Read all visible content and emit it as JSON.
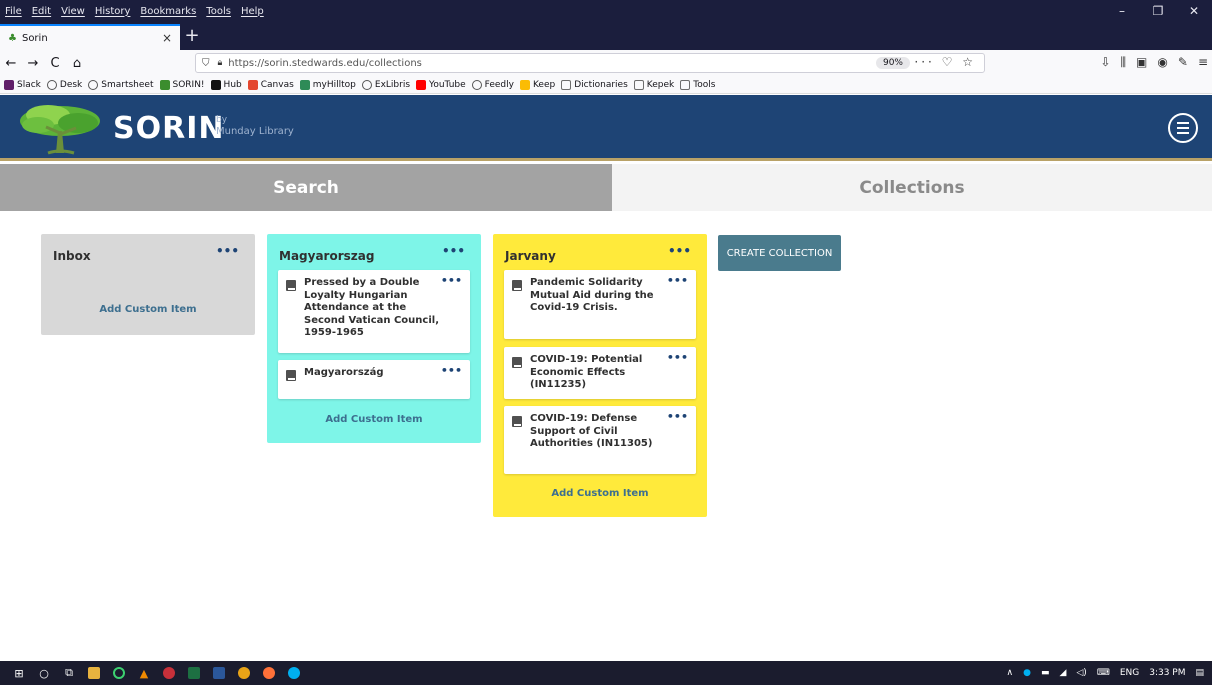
{
  "browser": {
    "menu": [
      "File",
      "Edit",
      "View",
      "History",
      "Bookmarks",
      "Tools",
      "Help"
    ],
    "window_controls": [
      "–",
      "❐",
      "✕"
    ],
    "tab": {
      "title": "Sorin",
      "close": "×"
    },
    "new_tab": "+",
    "nav": {
      "back": "←",
      "forward": "→",
      "reload": "C",
      "home": "⌂"
    },
    "url": "https://sorin.stedwards.edu/collections",
    "zoom": "90%",
    "url_actions": "··· ♡ ☆",
    "bookmarks": [
      {
        "label": "Slack",
        "icon": "slack-icon",
        "color": "#611f69"
      },
      {
        "label": "Desk",
        "icon": "globe-icon",
        "color": "#555555"
      },
      {
        "label": "Smartsheet",
        "icon": "globe-icon",
        "color": "#555555"
      },
      {
        "label": "SORIN!",
        "icon": "tree-icon",
        "color": "#3b8d2e"
      },
      {
        "label": "Hub",
        "icon": "notion-icon",
        "color": "#111111"
      },
      {
        "label": "Canvas",
        "icon": "canvas-icon",
        "color": "#e4472f"
      },
      {
        "label": "myHilltop",
        "icon": "hilltop-icon",
        "color": "#2e8b57"
      },
      {
        "label": "ExLibris",
        "icon": "globe-icon",
        "color": "#555555"
      },
      {
        "label": "YouTube",
        "icon": "youtube-icon",
        "color": "#ff0000"
      },
      {
        "label": "Feedly",
        "icon": "globe-icon",
        "color": "#555555"
      },
      {
        "label": "Keep",
        "icon": "keep-icon",
        "color": "#fbbc04"
      },
      {
        "label": "Dictionaries",
        "icon": "folder-icon",
        "color": "#6d6d6d"
      },
      {
        "label": "Kepek",
        "icon": "folder-icon",
        "color": "#6d6d6d"
      },
      {
        "label": "Tools",
        "icon": "folder-icon",
        "color": "#6d6d6d"
      }
    ]
  },
  "header": {
    "brand": "SORIN",
    "by": "by",
    "subtitle": "Munday Library",
    "colors": {
      "bar": "#1e4475",
      "accent": "#b9a267"
    }
  },
  "tabs": {
    "search": "Search",
    "collections": "Collections"
  },
  "columns": {
    "inbox": {
      "title": "Inbox",
      "dots": "•••",
      "add": "Add Custom Item",
      "color": "#d8d8d8"
    },
    "magyarorszag": {
      "title": "Magyarorszag",
      "dots": "•••",
      "add": "Add Custom Item",
      "color": "#7ef5e8",
      "items": [
        {
          "title": "Pressed by a Double Loyalty Hungarian Attendance at the Second Vatican Council, 1959-1965",
          "dots": "•••"
        },
        {
          "title": "Magyarország",
          "dots": "•••"
        }
      ]
    },
    "jarvany": {
      "title": "Jarvany",
      "dots": "•••",
      "add": "Add Custom Item",
      "color": "#ffea3b",
      "items": [
        {
          "title": "Pandemic Solidarity Mutual Aid during the Covid-19 Crisis.",
          "dots": "•••"
        },
        {
          "title": "COVID-19: Potential Economic Effects (IN11235)",
          "dots": "•••"
        },
        {
          "title": "COVID-19: Defense Support of Civil Authorities (IN11305)",
          "dots": "•••"
        }
      ]
    }
  },
  "create_button": "CREATE COLLECTION",
  "taskbar": {
    "tray_lang": "ENG",
    "time": "3:33 PM"
  }
}
